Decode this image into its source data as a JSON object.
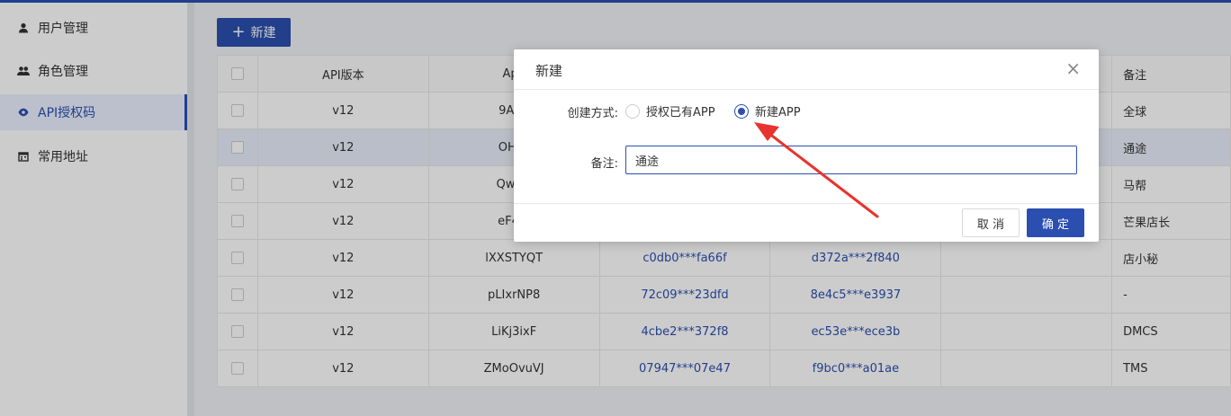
{
  "sidebar": {
    "items": [
      {
        "label": "用户管理",
        "icon": "user-icon"
      },
      {
        "label": "角色管理",
        "icon": "users-icon"
      },
      {
        "label": "API授权码",
        "icon": "eye-icon"
      },
      {
        "label": "常用地址",
        "icon": "calendar-icon"
      }
    ]
  },
  "toolbar": {
    "new_label": "新建"
  },
  "table": {
    "headers": [
      "API版本",
      "App",
      "",
      "",
      "",
      "备注"
    ],
    "rows": [
      {
        "version": "v12",
        "app": "9AZa",
        "key": "",
        "secret": "",
        "extra": "",
        "note": "全球"
      },
      {
        "version": "v12",
        "app": "OHNt",
        "key": "",
        "secret": "",
        "extra": "",
        "note": "通途"
      },
      {
        "version": "v12",
        "app": "QwGp",
        "key": "",
        "secret": "",
        "extra": "",
        "note": "马帮"
      },
      {
        "version": "v12",
        "app": "eF4Y/",
        "key": "",
        "secret": "",
        "extra": "",
        "note": "芒果店长"
      },
      {
        "version": "v12",
        "app": "lXXSTYQT",
        "key": "c0db0***fa66f",
        "secret": "d372a***2f840",
        "extra": "",
        "note": "店小秘"
      },
      {
        "version": "v12",
        "app": "pLIxrNP8",
        "key": "72c09***23dfd",
        "secret": "8e4c5***e3937",
        "extra": "",
        "note": "-"
      },
      {
        "version": "v12",
        "app": "LiKj3ixF",
        "key": "4cbe2***372f8",
        "secret": "ec53e***ece3b",
        "extra": "",
        "note": "DMCS"
      },
      {
        "version": "v12",
        "app": "ZMoOvuVJ",
        "key": "07947***07e47",
        "secret": "f9bc0***a01ae",
        "extra": "",
        "note": "TMS"
      }
    ]
  },
  "modal": {
    "title": "新建",
    "close": "×",
    "create_mode_label": "创建方式:",
    "options": [
      "授权已有APP",
      "新建APP"
    ],
    "selected": 1,
    "note_label": "备注:",
    "note_value": "通途",
    "cancel_label": "取 消",
    "ok_label": "确 定"
  },
  "colors": {
    "accent": "#2b4fb0",
    "annotation": "#e8342e"
  }
}
